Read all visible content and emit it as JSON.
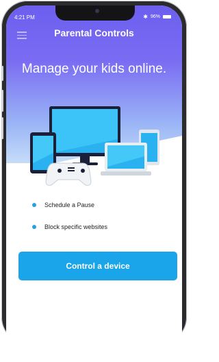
{
  "status_bar": {
    "time": "4:21 PM",
    "battery": "96%"
  },
  "header": {
    "title": "Parental Controls"
  },
  "hero": {
    "tagline": "Manage your kids online."
  },
  "features": {
    "items": [
      {
        "label": "Schedule a Pause"
      },
      {
        "label": "Block specific websites"
      }
    ]
  },
  "cta": {
    "label": "Control a device"
  },
  "colors": {
    "hero_top": "#6c5fef",
    "hero_bottom": "#c6ddf8",
    "accent": "#1aa5ea",
    "bullet": "#27a2e0"
  },
  "icons": [
    "menu-icon",
    "bluetooth-icon",
    "battery-icon"
  ]
}
